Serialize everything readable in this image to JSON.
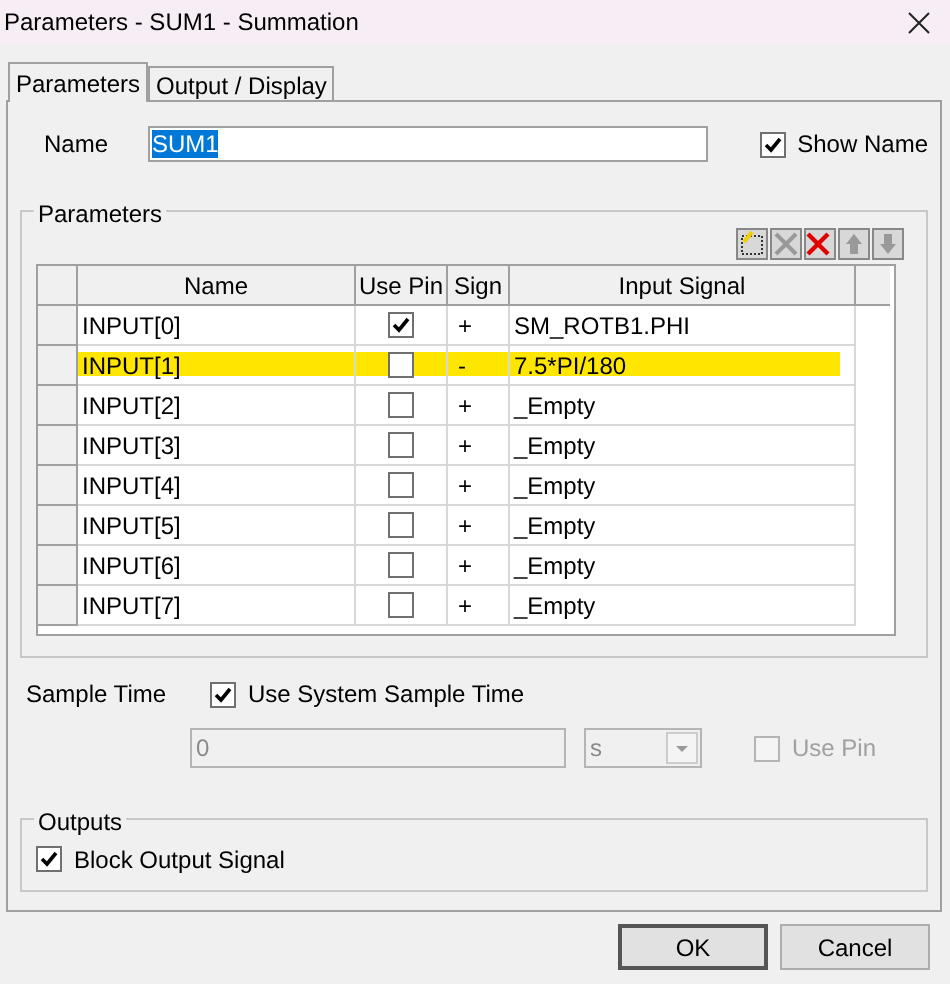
{
  "window": {
    "title": "Parameters - SUM1 - Summation"
  },
  "tabs": [
    {
      "label": "Parameters",
      "selected": true
    },
    {
      "label": "Output / Display",
      "selected": false
    }
  ],
  "name_field": {
    "label": "Name",
    "value": "SUM1"
  },
  "show_name": {
    "label": "Show Name",
    "checked": true
  },
  "parameters_group": {
    "title": "Parameters"
  },
  "table": {
    "columns": [
      "Name",
      "Use Pin",
      "Sign",
      "Input Signal"
    ],
    "rows": [
      {
        "name": "INPUT[0]",
        "use_pin": true,
        "sign": "+",
        "input_signal": "SM_ROTB1.PHI",
        "highlighted": false
      },
      {
        "name": "INPUT[1]",
        "use_pin": false,
        "sign": "-",
        "input_signal": "7.5*PI/180",
        "highlighted": true
      },
      {
        "name": "INPUT[2]",
        "use_pin": false,
        "sign": "+",
        "input_signal": "_Empty",
        "highlighted": false
      },
      {
        "name": "INPUT[3]",
        "use_pin": false,
        "sign": "+",
        "input_signal": "_Empty",
        "highlighted": false
      },
      {
        "name": "INPUT[4]",
        "use_pin": false,
        "sign": "+",
        "input_signal": "_Empty",
        "highlighted": false
      },
      {
        "name": "INPUT[5]",
        "use_pin": false,
        "sign": "+",
        "input_signal": "_Empty",
        "highlighted": false
      },
      {
        "name": "INPUT[6]",
        "use_pin": false,
        "sign": "+",
        "input_signal": "_Empty",
        "highlighted": false
      },
      {
        "name": "INPUT[7]",
        "use_pin": false,
        "sign": "+",
        "input_signal": "_Empty",
        "highlighted": false
      }
    ]
  },
  "sample_time": {
    "label": "Sample Time",
    "use_system": {
      "label": "Use System Sample Time",
      "checked": true
    },
    "value": "0",
    "unit": "s",
    "use_pin": {
      "label": "Use Pin",
      "checked": false,
      "disabled": true
    }
  },
  "outputs_group": {
    "title": "Outputs",
    "block_output": {
      "label": "Block Output Signal",
      "checked": true
    }
  },
  "buttons": [
    "OK",
    "Cancel"
  ]
}
